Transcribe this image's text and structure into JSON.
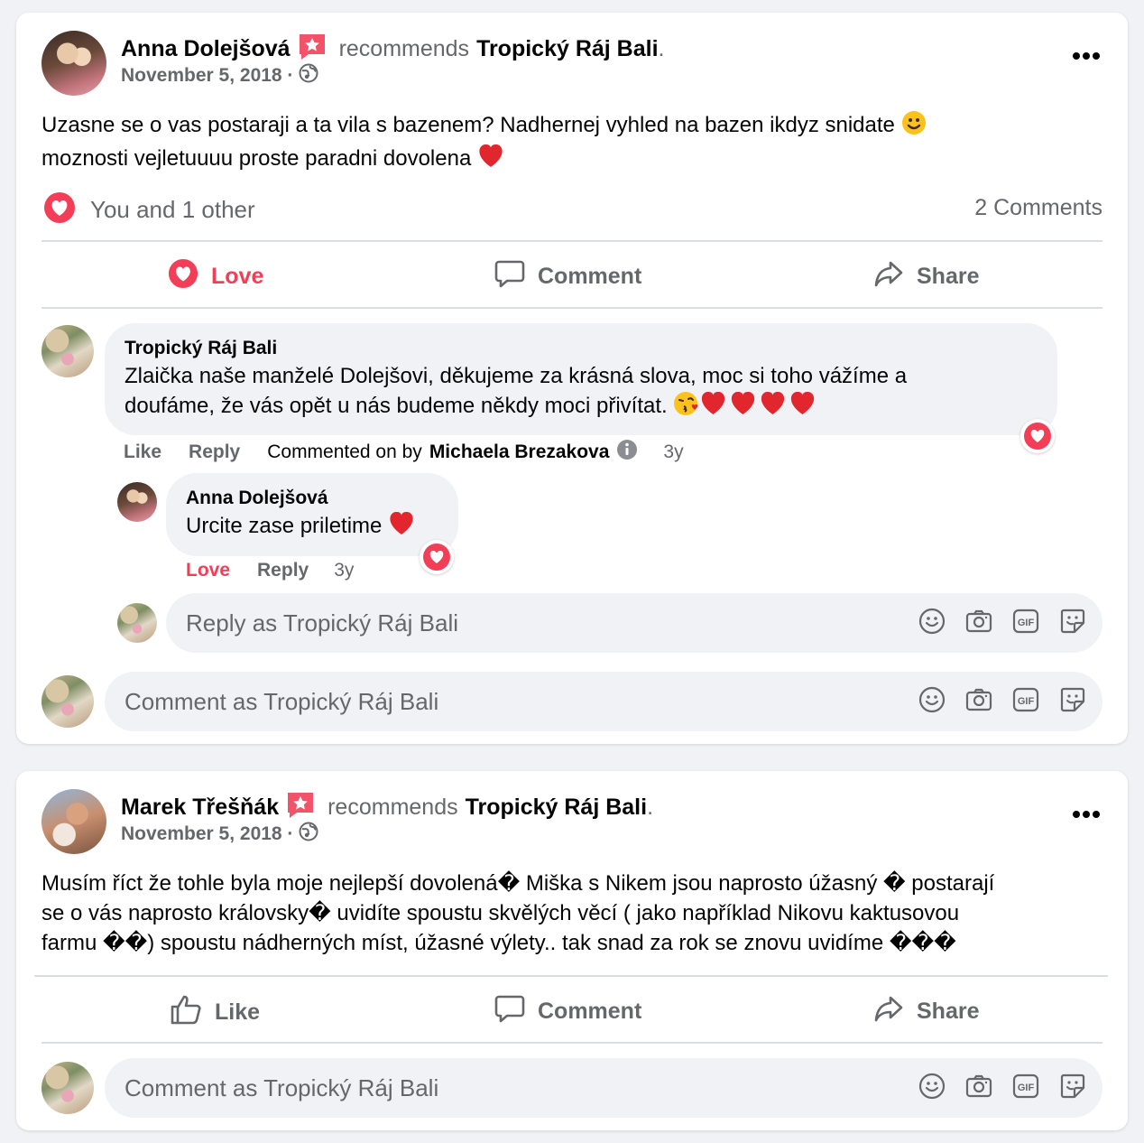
{
  "post1": {
    "author": "Anna Dolejšová",
    "recommends_word": "recommends",
    "page_name": "Tropický Ráj Bali",
    "period": ".",
    "date": "November 5, 2018 ·",
    "text_line1": "Uzasne se o vas postaraji a ta vila s bazenem? Nadhernej vyhled na bazen ikdyz snidate",
    "text_line2": "moznosti vejletuuuu proste paradni dovolena",
    "reactions_text": "You and 1 other",
    "comments_count": "2 Comments",
    "actions": {
      "love": "Love",
      "comment": "Comment",
      "share": "Share"
    },
    "comment1": {
      "author": "Tropický Ráj Bali",
      "line1": "Zlaička naše manželé Dolejšovi, děkujeme za krásná slova, moc si toho vážíme a",
      "line2": "doufáme, že vás opět u nás budeme někdy moci přivítat.",
      "like": "Like",
      "reply": "Reply",
      "commented_by_prefix": "Commented on by",
      "commented_by_name": "Michaela Brezakova",
      "time": "3y"
    },
    "reply1": {
      "author": "Anna Dolejšová",
      "text": "Urcite zase priletime",
      "love": "Love",
      "reply": "Reply",
      "time": "3y"
    },
    "reply_placeholder": "Reply as Tropický Ráj Bali",
    "comment_placeholder": "Comment as Tropický Ráj Bali"
  },
  "post2": {
    "author": "Marek Třešňák",
    "recommends_word": "recommends",
    "page_name": "Tropický Ráj Bali",
    "period": ".",
    "date": "November 5, 2018 ·",
    "text_line1": "Musím říct že tohle byla moje nejlepší dovolená� Miška s Nikem jsou naprosto úžasný � postarají",
    "text_line2": "se o vás naprosto královsky� uvidíte spoustu skvělých věcí ( jako například Nikovu kaktusovou",
    "text_line3": "farmu ��) spoustu nádherných míst, úžasné výlety.. tak snad za rok se znovu uvidíme ���",
    "actions": {
      "like": "Like",
      "comment": "Comment",
      "share": "Share"
    },
    "comment_placeholder": "Comment as Tropický Ráj Bali"
  },
  "colors": {
    "love_red": "#f33e58",
    "text_grey": "#65676b",
    "bubble_grey": "#f0f2f5",
    "recommend_badge": "#f35369"
  }
}
